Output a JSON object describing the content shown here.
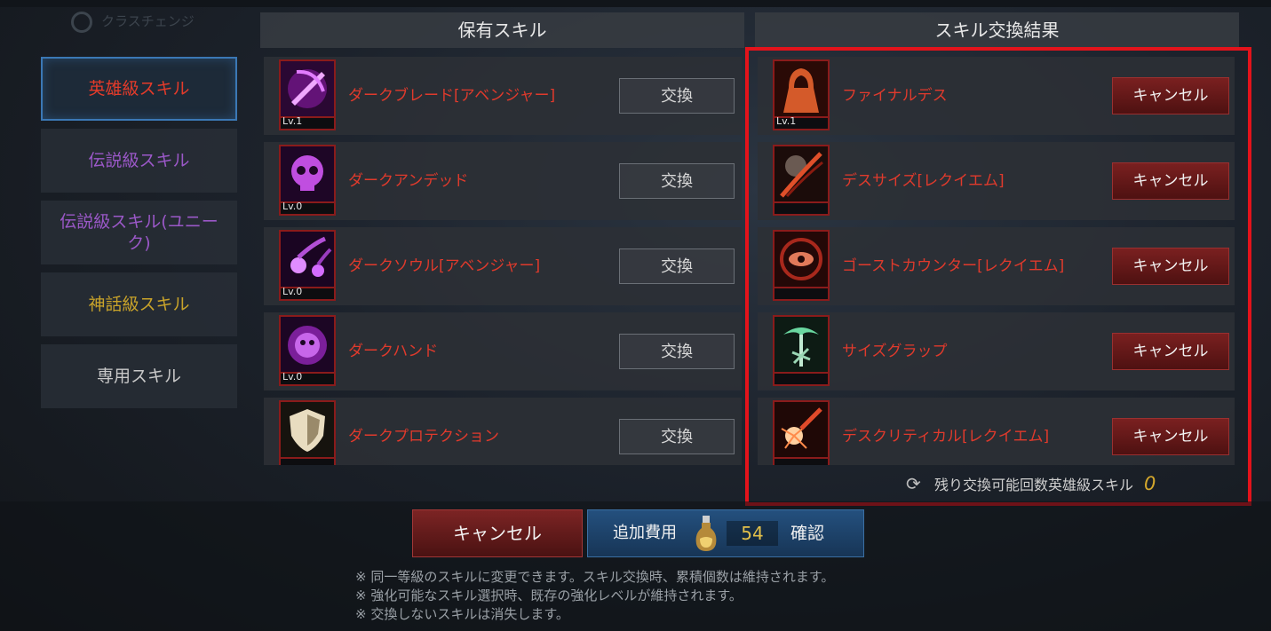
{
  "top_ghost_label": "クラスチェンジ",
  "categories": [
    {
      "label": "英雄級スキル",
      "color": "#e53b2a",
      "active": true
    },
    {
      "label": "伝説級スキル",
      "color": "#9b58c8"
    },
    {
      "label": "伝説級スキル(ユニーク)",
      "color": "#9b58c8"
    },
    {
      "label": "神話級スキル",
      "color": "#c9a32a"
    },
    {
      "label": "専用スキル",
      "color": "#c8c8c8"
    }
  ],
  "owned": {
    "header": "保有スキル",
    "button_label": "交換",
    "skills": [
      {
        "name": "ダークブレード[アベンジャー]",
        "level": "Lv.1",
        "icon": "dark-blade-icon"
      },
      {
        "name": "ダークアンデッド",
        "level": "Lv.0",
        "icon": "skull-icon"
      },
      {
        "name": "ダークソウル[アベンジャー]",
        "level": "Lv.0",
        "icon": "soul-orbs-icon"
      },
      {
        "name": "ダークハンド",
        "level": "Lv.0",
        "icon": "dark-hand-icon"
      },
      {
        "name": "ダークプロテクション",
        "level": "",
        "icon": "shield-icon"
      }
    ]
  },
  "result": {
    "header": "スキル交換結果",
    "button_label": "キャンセル",
    "skills": [
      {
        "name": "ファイナルデス",
        "level": "Lv.1",
        "icon": "hooded-figure-icon"
      },
      {
        "name": "デスサイズ[レクイエム]",
        "level": "",
        "icon": "death-scythe-icon"
      },
      {
        "name": "ゴーストカウンター[レクイエム]",
        "level": "",
        "icon": "ghost-eye-icon"
      },
      {
        "name": "サイズグラップ",
        "level": "",
        "icon": "scythe-grab-icon"
      },
      {
        "name": "デスクリティカル[レクイエム]",
        "level": "",
        "icon": "critical-strike-icon"
      }
    ],
    "remaining_label": "残り交換可能回数英雄級スキル",
    "remaining_count": "0"
  },
  "footer": {
    "cancel_label": "キャンセル",
    "extra_cost_label": "追加費用",
    "cost_value": "54",
    "confirm_label": "確認",
    "notes": [
      "※ 同一等級のスキルに変更できます。スキル交換時、累積個数は維持されます。",
      "※ 強化可能なスキル選択時、既存の強化レベルが維持されます。",
      "※ 交換しないスキルは消失します。"
    ]
  },
  "colors": {
    "highlight_frame": "#e3131b",
    "skill_name": "#e03a2c",
    "cost": "#e3c04a"
  }
}
